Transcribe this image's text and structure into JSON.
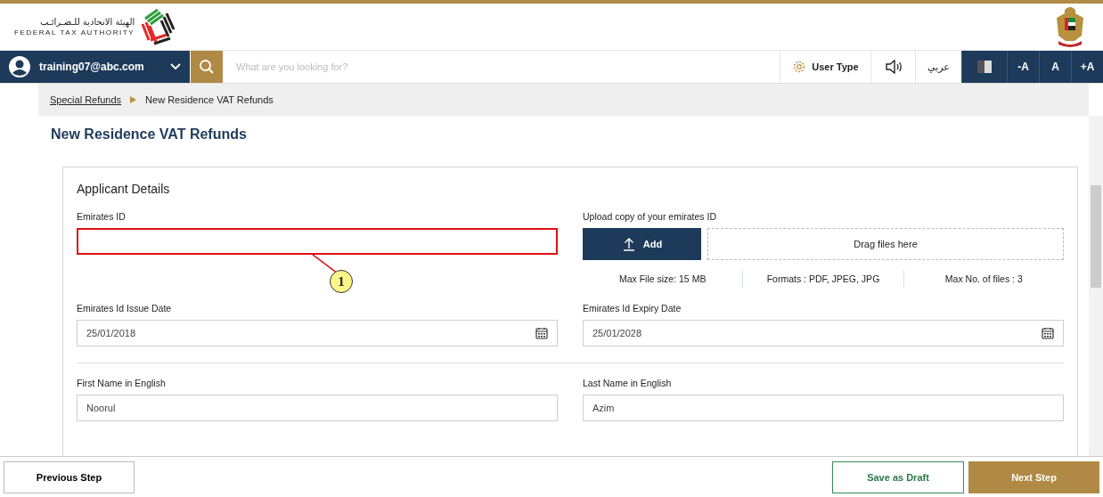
{
  "header": {
    "logo_arabic": "الهيئة الاتحادية للـضـرائـب",
    "logo_english": "FEDERAL TAX AUTHORITY"
  },
  "nav": {
    "user": "training07@abc.com",
    "search": {
      "placeholder": "What are you looking for?"
    },
    "user_type": "User Type",
    "language": "عربي",
    "font_buttons": [
      "-A",
      "A",
      "+A"
    ]
  },
  "breadcrumb": [
    {
      "label": "Special Refunds",
      "link": true
    },
    {
      "label": "New Residence VAT Refunds",
      "link": false
    }
  ],
  "page_title": "New Residence VAT Refunds",
  "section": {
    "title": "Applicant Details",
    "rows": [
      {
        "divided": false,
        "fields": [
          {
            "kind": "text",
            "label": "Emirates ID",
            "highlighted": true,
            "callout": "1"
          },
          {
            "kind": "upload",
            "label": "Upload copy of your emirates ID",
            "button": "Add",
            "drop": "Drag files here",
            "notes": [
              "Max File size: 15 MB",
              "Formats : PDF, JPEG, JPG",
              "Max No. of files : 3"
            ]
          }
        ]
      },
      {
        "divided": false,
        "fields": [
          {
            "kind": "date",
            "label": "Emirates Id Issue Date",
            "value": "25/01/2018",
            "highlighted": false
          },
          {
            "kind": "date",
            "label": "Emirates Id Expiry Date",
            "value": "25/01/2028",
            "highlighted": false
          }
        ]
      },
      {
        "divided": true,
        "fields": [
          {
            "kind": "text",
            "label": "First Name in English",
            "value": "Noorul",
            "highlighted": false
          },
          {
            "kind": "text",
            "label": "Last Name in English",
            "value": "Azim",
            "highlighted": false
          }
        ]
      }
    ]
  },
  "footer": {
    "previous": "Previous Step",
    "draft": "Save as Draft",
    "next": "Next Step"
  }
}
